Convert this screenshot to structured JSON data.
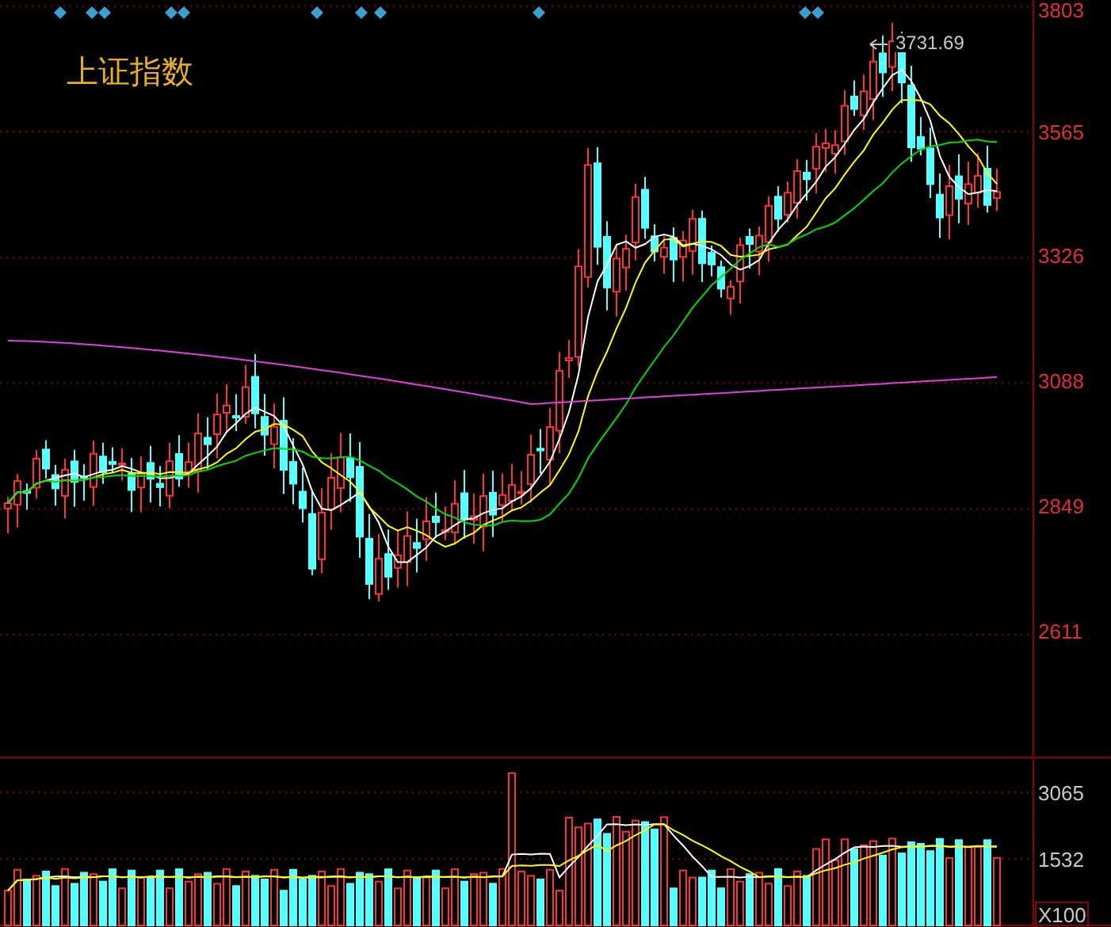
{
  "title": "上证指数",
  "price_axis": {
    "labels": [
      "3803",
      "3565",
      "3326",
      "3088",
      "2849",
      "2611"
    ]
  },
  "max_marker": {
    "label": "3731.69"
  },
  "volume_axis": {
    "labels": [
      "3065",
      "1532"
    ],
    "unit": "X100"
  }
}
